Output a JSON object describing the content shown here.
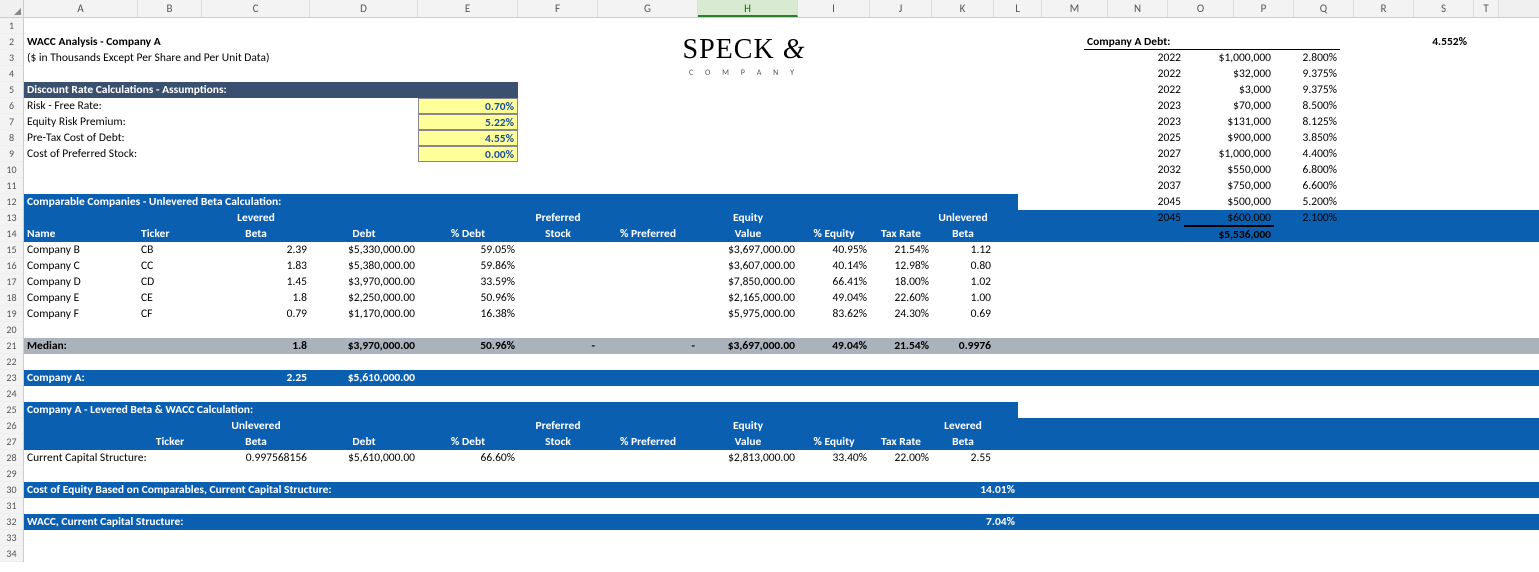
{
  "columns": [
    "A",
    "B",
    "C",
    "D",
    "E",
    "F",
    "G",
    "H",
    "I",
    "J",
    "K",
    "L",
    "M",
    "N",
    "O",
    "P",
    "Q",
    "R",
    "S",
    "T"
  ],
  "active_col": "H",
  "row_count": 34,
  "logo": {
    "main": "SPECK",
    "amp": "&",
    "sub": "C O M P A N Y"
  },
  "title": "WACC Analysis - Company A",
  "subtitle": "($ in Thousands Except Per Share and Per Unit Data)",
  "assumptions": {
    "header": "Discount Rate Calculations - Assumptions:",
    "rows": [
      {
        "label": "Risk - Free Rate:",
        "value": "0.70%"
      },
      {
        "label": "Equity Risk Premium:",
        "value": "5.22%"
      },
      {
        "label": "Pre-Tax Cost of Debt:",
        "value": "4.55%"
      },
      {
        "label": "Cost of Preferred Stock:",
        "value": "0.00%"
      }
    ]
  },
  "comps": {
    "header": "Comparable Companies - Unlevered Beta Calculation:",
    "col_top": {
      "levered": "Levered",
      "preferred": "Preferred",
      "equity": "Equity",
      "unlevered": "Unlevered"
    },
    "cols": {
      "name": "Name",
      "ticker": "Ticker",
      "beta": "Beta",
      "debt": "Debt",
      "pdebt": "% Debt",
      "stock": "Stock",
      "ppref": "% Preferred",
      "value": "Value",
      "pequity": "% Equity",
      "tax": "Tax Rate",
      "ubeta": "Beta"
    },
    "rows": [
      {
        "name": "Company B",
        "ticker": "CB",
        "lbeta": "2.39",
        "debt": "$5,330,000.00",
        "pdebt": "59.05%",
        "pref": "",
        "ppref": "",
        "equity": "$3,697,000.00",
        "pequity": "40.95%",
        "tax": "21.54%",
        "ubeta": "1.12"
      },
      {
        "name": "Company C",
        "ticker": "CC",
        "lbeta": "1.83",
        "debt": "$5,380,000.00",
        "pdebt": "59.86%",
        "pref": "",
        "ppref": "",
        "equity": "$3,607,000.00",
        "pequity": "40.14%",
        "tax": "12.98%",
        "ubeta": "0.80"
      },
      {
        "name": "Company D",
        "ticker": "CD",
        "lbeta": "1.45",
        "debt": "$3,970,000.00",
        "pdebt": "33.59%",
        "pref": "",
        "ppref": "",
        "equity": "$7,850,000.00",
        "pequity": "66.41%",
        "tax": "18.00%",
        "ubeta": "1.02"
      },
      {
        "name": "Company E",
        "ticker": "CE",
        "lbeta": "1.8",
        "debt": "$2,250,000.00",
        "pdebt": "50.96%",
        "pref": "",
        "ppref": "",
        "equity": "$2,165,000.00",
        "pequity": "49.04%",
        "tax": "22.60%",
        "ubeta": "1.00"
      },
      {
        "name": "Company F",
        "ticker": "CF",
        "lbeta": "0.79",
        "debt": "$1,170,000.00",
        "pdebt": "16.38%",
        "pref": "",
        "ppref": "",
        "equity": "$5,975,000.00",
        "pequity": "83.62%",
        "tax": "24.30%",
        "ubeta": "0.69"
      }
    ],
    "median": {
      "label": "Median:",
      "lbeta": "1.8",
      "debt": "$3,970,000.00",
      "pdebt": "50.96%",
      "pref": "-",
      "ppref": "-",
      "equity": "$3,697,000.00",
      "pequity": "49.04%",
      "tax": "21.54%",
      "ubeta": "0.9976"
    },
    "companyA": {
      "label": "Company A:",
      "lbeta": "2.25",
      "debt": "$5,610,000.00"
    }
  },
  "wacc": {
    "header": "Company A - Levered Beta & WACC Calculation:",
    "col_top": {
      "unlevered": "Unlevered",
      "preferred": "Preferred",
      "equity": "Equity",
      "levered": "Levered"
    },
    "cols": {
      "ticker": "Ticker",
      "beta": "Beta",
      "debt": "Debt",
      "pdebt": "% Debt",
      "stock": "Stock",
      "ppref": "% Preferred",
      "value": "Value",
      "pequity": "% Equity",
      "tax": "Tax Rate",
      "lbeta": "Beta"
    },
    "row": {
      "label": "Current Capital Structure:",
      "ubeta": "0.997568156",
      "debt": "$5,610,000.00",
      "pdebt": "66.60%",
      "pref": "",
      "ppref": "",
      "equity": "$2,813,000.00",
      "pequity": "33.40%",
      "tax": "22.00%",
      "lbeta": "2.55"
    },
    "coe": {
      "label": "Cost of Equity Based on Comparables, Current Capital Structure:",
      "value": "14.01%"
    },
    "wacc_val": {
      "label": "WACC, Current Capital Structure:",
      "value": "7.04%"
    }
  },
  "debt": {
    "header": "Company A Debt:",
    "rows": [
      {
        "year": "2022",
        "amt": "$1,000,000",
        "rate": "2.800%"
      },
      {
        "year": "2022",
        "amt": "$32,000",
        "rate": "9.375%"
      },
      {
        "year": "2022",
        "amt": "$3,000",
        "rate": "9.375%"
      },
      {
        "year": "2023",
        "amt": "$70,000",
        "rate": "8.500%"
      },
      {
        "year": "2023",
        "amt": "$131,000",
        "rate": "8.125%"
      },
      {
        "year": "2025",
        "amt": "$900,000",
        "rate": "3.850%"
      },
      {
        "year": "2027",
        "amt": "$1,000,000",
        "rate": "4.400%"
      },
      {
        "year": "2032",
        "amt": "$550,000",
        "rate": "6.800%"
      },
      {
        "year": "2037",
        "amt": "$750,000",
        "rate": "6.600%"
      },
      {
        "year": "2045",
        "amt": "$500,000",
        "rate": "5.200%"
      },
      {
        "year": "2045",
        "amt": "$600,000",
        "rate": "2.100%"
      }
    ],
    "total": "$5,536,000",
    "derived": "4.552%"
  }
}
